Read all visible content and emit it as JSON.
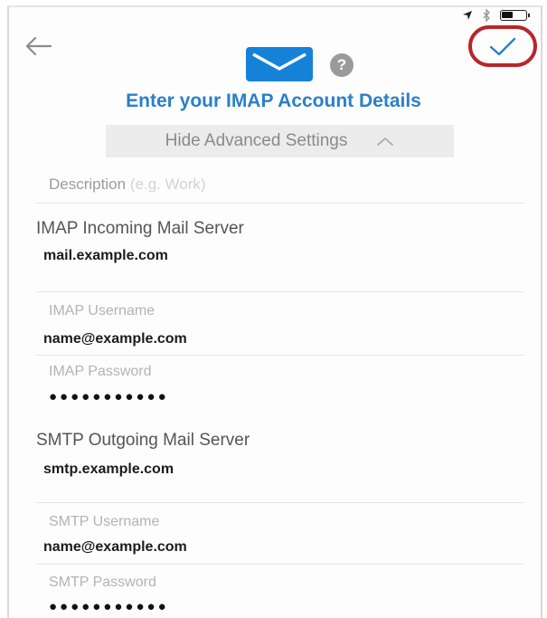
{
  "header": {
    "title": "Enter your IMAP Account Details",
    "help_label": "?"
  },
  "advanced_toggle": {
    "label": "Hide Advanced Settings"
  },
  "description": {
    "label": "Description",
    "placeholder": "(e.g. Work)"
  },
  "incoming": {
    "section_title": "IMAP Incoming Mail Server",
    "server": "mail.example.com",
    "username_label": "IMAP Username",
    "username": "name@example.com",
    "password_label": "IMAP Password",
    "password_mask": "●●●●●●●●●●●"
  },
  "outgoing": {
    "section_title": "SMTP Outgoing Mail Server",
    "server": "smtp.example.com",
    "username_label": "SMTP Username",
    "username": "name@example.com",
    "password_label": "SMTP Password",
    "password_mask": "●●●●●●●●●●●"
  },
  "colors": {
    "accent": "#2a7fc9",
    "mail_icon": "#1582d8",
    "highlight_circle": "#b7262b"
  },
  "icons": [
    "back-arrow-icon",
    "mail-icon",
    "help-icon",
    "checkmark-icon",
    "chevron-up-icon",
    "location-icon",
    "bluetooth-icon",
    "battery-icon"
  ]
}
